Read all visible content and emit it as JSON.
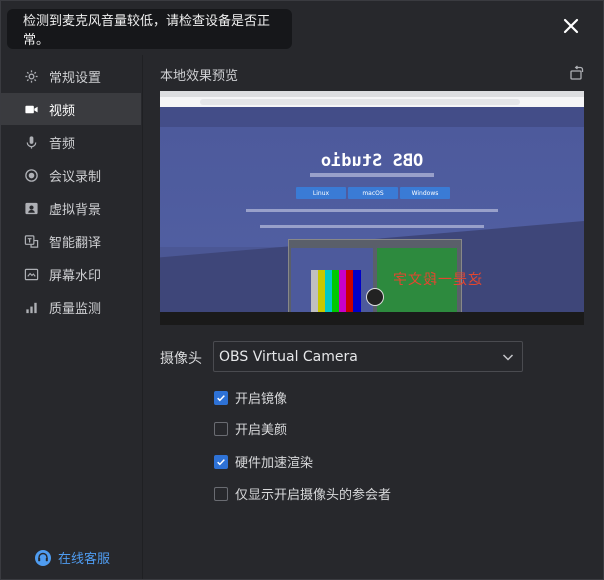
{
  "toast": {
    "message": "检测到麦克风音量较低，请检查设备是否正常。"
  },
  "sidebar": {
    "items": [
      {
        "label": "常规设置",
        "icon": "gear-icon"
      },
      {
        "label": "视频",
        "icon": "video-camera-icon",
        "active": true
      },
      {
        "label": "音频",
        "icon": "microphone-icon"
      },
      {
        "label": "会议录制",
        "icon": "record-icon"
      },
      {
        "label": "虚拟背景",
        "icon": "portrait-icon"
      },
      {
        "label": "智能翻译",
        "icon": "translate-icon"
      },
      {
        "label": "屏幕水印",
        "icon": "watermark-icon"
      },
      {
        "label": "质量监测",
        "icon": "signal-bars-icon"
      }
    ],
    "support_label": "在线客服"
  },
  "video": {
    "preview_title": "本地效果预览",
    "preview": {
      "obs_title": "OBS Studio",
      "buttons": [
        "Windows",
        "macOS",
        "Linux"
      ],
      "mirrored_text": "这是一段文字"
    },
    "camera_label": "摄像头",
    "camera_value": "OBS Virtual Camera",
    "options": [
      {
        "label": "开启镜像",
        "checked": true
      },
      {
        "label": "开启美颜",
        "checked": false
      },
      {
        "label": "硬件加速渲染",
        "checked": true
      },
      {
        "label": "仅显示开启摄像头的参会者",
        "checked": false
      }
    ]
  },
  "colors": {
    "accent": "#2e72d6",
    "link": "#4f9cf0",
    "background": "#27282c",
    "active_item": "#3a3b3f"
  }
}
